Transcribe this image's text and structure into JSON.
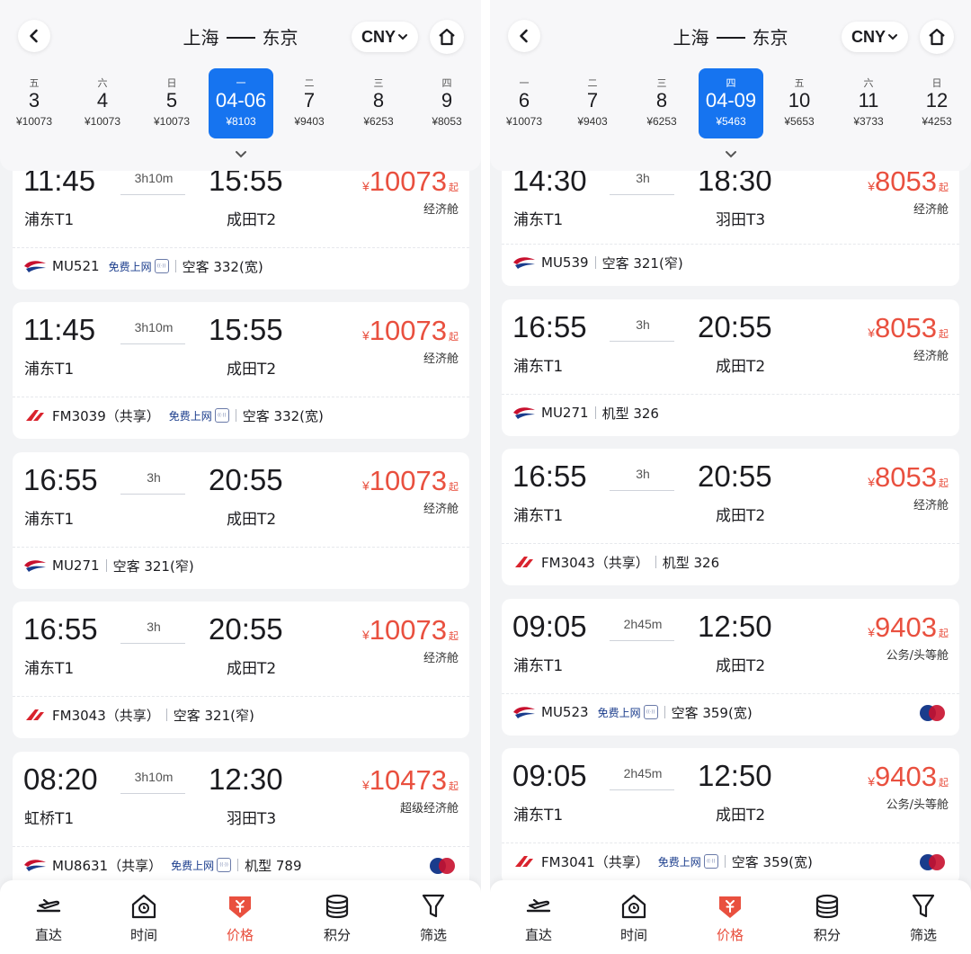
{
  "panels": [
    {
      "route": {
        "from": "上海",
        "to": "东京"
      },
      "currency": "CNY",
      "dates": [
        {
          "weekday": "五",
          "day": "3",
          "price": "¥10073",
          "selected": false
        },
        {
          "weekday": "六",
          "day": "4",
          "price": "¥10073",
          "selected": false
        },
        {
          "weekday": "日",
          "day": "5",
          "price": "¥10073",
          "selected": false
        },
        {
          "weekday": "一",
          "day": "04-06",
          "price": "¥8103",
          "selected": true
        },
        {
          "weekday": "二",
          "day": "7",
          "price": "¥9403",
          "selected": false
        },
        {
          "weekday": "三",
          "day": "8",
          "price": "¥6253",
          "selected": false
        },
        {
          "weekday": "四",
          "day": "9",
          "price": "¥8053",
          "selected": false
        }
      ],
      "flights": [
        {
          "dep_time": "11:45",
          "arr_time": "15:55",
          "dep_airport": "浦东T1",
          "arr_airport": "成田T2",
          "duration": "3h10m",
          "yen": "¥",
          "price": "10073",
          "qi": "起",
          "cabin": "经济舱",
          "flight_no": "MU521",
          "logo": "mu",
          "wifi": "免费上网",
          "aircraft": "空客 332(宽)",
          "cards": false
        },
        {
          "dep_time": "11:45",
          "arr_time": "15:55",
          "dep_airport": "浦东T1",
          "arr_airport": "成田T2",
          "duration": "3h10m",
          "yen": "¥",
          "price": "10073",
          "qi": "起",
          "cabin": "经济舱",
          "flight_no": "FM3039（共享）",
          "logo": "fm",
          "wifi": "免费上网",
          "aircraft": "空客 332(宽)",
          "cards": false
        },
        {
          "dep_time": "16:55",
          "arr_time": "20:55",
          "dep_airport": "浦东T1",
          "arr_airport": "成田T2",
          "duration": "3h",
          "yen": "¥",
          "price": "10073",
          "qi": "起",
          "cabin": "经济舱",
          "flight_no": "MU271",
          "logo": "mu",
          "wifi": "",
          "aircraft": "空客 321(窄)",
          "cards": false
        },
        {
          "dep_time": "16:55",
          "arr_time": "20:55",
          "dep_airport": "浦东T1",
          "arr_airport": "成田T2",
          "duration": "3h",
          "yen": "¥",
          "price": "10073",
          "qi": "起",
          "cabin": "经济舱",
          "flight_no": "FM3043（共享）",
          "logo": "fm",
          "wifi": "",
          "aircraft": "空客 321(窄)",
          "cards": false
        },
        {
          "dep_time": "08:20",
          "arr_time": "12:30",
          "dep_airport": "虹桥T1",
          "arr_airport": "羽田T3",
          "duration": "3h10m",
          "yen": "¥",
          "price": "10473",
          "qi": "起",
          "cabin": "超级经济舱",
          "flight_no": "MU8631（共享）",
          "logo": "mu",
          "wifi": "免费上网",
          "aircraft": "机型 789",
          "cards": true
        }
      ]
    },
    {
      "route": {
        "from": "上海",
        "to": "东京"
      },
      "currency": "CNY",
      "dates": [
        {
          "weekday": "一",
          "day": "6",
          "price": "¥10073",
          "selected": false
        },
        {
          "weekday": "二",
          "day": "7",
          "price": "¥9403",
          "selected": false
        },
        {
          "weekday": "三",
          "day": "8",
          "price": "¥6253",
          "selected": false
        },
        {
          "weekday": "四",
          "day": "04-09",
          "price": "¥5463",
          "selected": true
        },
        {
          "weekday": "五",
          "day": "10",
          "price": "¥5653",
          "selected": false
        },
        {
          "weekday": "六",
          "day": "11",
          "price": "¥3733",
          "selected": false
        },
        {
          "weekday": "日",
          "day": "12",
          "price": "¥4253",
          "selected": false
        }
      ],
      "flights": [
        {
          "dep_time": "14:30",
          "arr_time": "18:30",
          "dep_airport": "浦东T1",
          "arr_airport": "羽田T3",
          "duration": "3h",
          "yen": "¥",
          "price": "8053",
          "qi": "起",
          "cabin": "经济舱",
          "flight_no": "MU539",
          "logo": "mu",
          "wifi": "",
          "aircraft": "空客 321(窄)",
          "cards": false
        },
        {
          "dep_time": "16:55",
          "arr_time": "20:55",
          "dep_airport": "浦东T1",
          "arr_airport": "成田T2",
          "duration": "3h",
          "yen": "¥",
          "price": "8053",
          "qi": "起",
          "cabin": "经济舱",
          "flight_no": "MU271",
          "logo": "mu",
          "wifi": "",
          "aircraft": "机型 326",
          "cards": false
        },
        {
          "dep_time": "16:55",
          "arr_time": "20:55",
          "dep_airport": "浦东T1",
          "arr_airport": "成田T2",
          "duration": "3h",
          "yen": "¥",
          "price": "8053",
          "qi": "起",
          "cabin": "经济舱",
          "flight_no": "FM3043（共享）",
          "logo": "fm",
          "wifi": "",
          "aircraft": "机型 326",
          "cards": false
        },
        {
          "dep_time": "09:05",
          "arr_time": "12:50",
          "dep_airport": "浦东T1",
          "arr_airport": "成田T2",
          "duration": "2h45m",
          "yen": "¥",
          "price": "9403",
          "qi": "起",
          "cabin": "公务/头等舱",
          "flight_no": "MU523",
          "logo": "mu",
          "wifi": "免费上网",
          "aircraft": "空客 359(宽)",
          "cards": true
        },
        {
          "dep_time": "09:05",
          "arr_time": "12:50",
          "dep_airport": "浦东T1",
          "arr_airport": "成田T2",
          "duration": "2h45m",
          "yen": "¥",
          "price": "9403",
          "qi": "起",
          "cabin": "公务/头等舱",
          "flight_no": "FM3041（共享）",
          "logo": "fm",
          "wifi": "免费上网",
          "aircraft": "空客 359(宽)",
          "cards": true
        }
      ]
    }
  ],
  "tabbar": [
    {
      "label": "直达",
      "icon": "direct-flight-icon",
      "active": false
    },
    {
      "label": "时间",
      "icon": "clock-house-icon",
      "active": false
    },
    {
      "label": "价格",
      "icon": "price-tag-icon",
      "active": true
    },
    {
      "label": "积分",
      "icon": "points-coins-icon",
      "active": false
    },
    {
      "label": "筛选",
      "icon": "filter-funnel-icon",
      "active": false
    }
  ],
  "colors": {
    "accent_blue": "#1674f0",
    "price_red": "#e9503f"
  }
}
